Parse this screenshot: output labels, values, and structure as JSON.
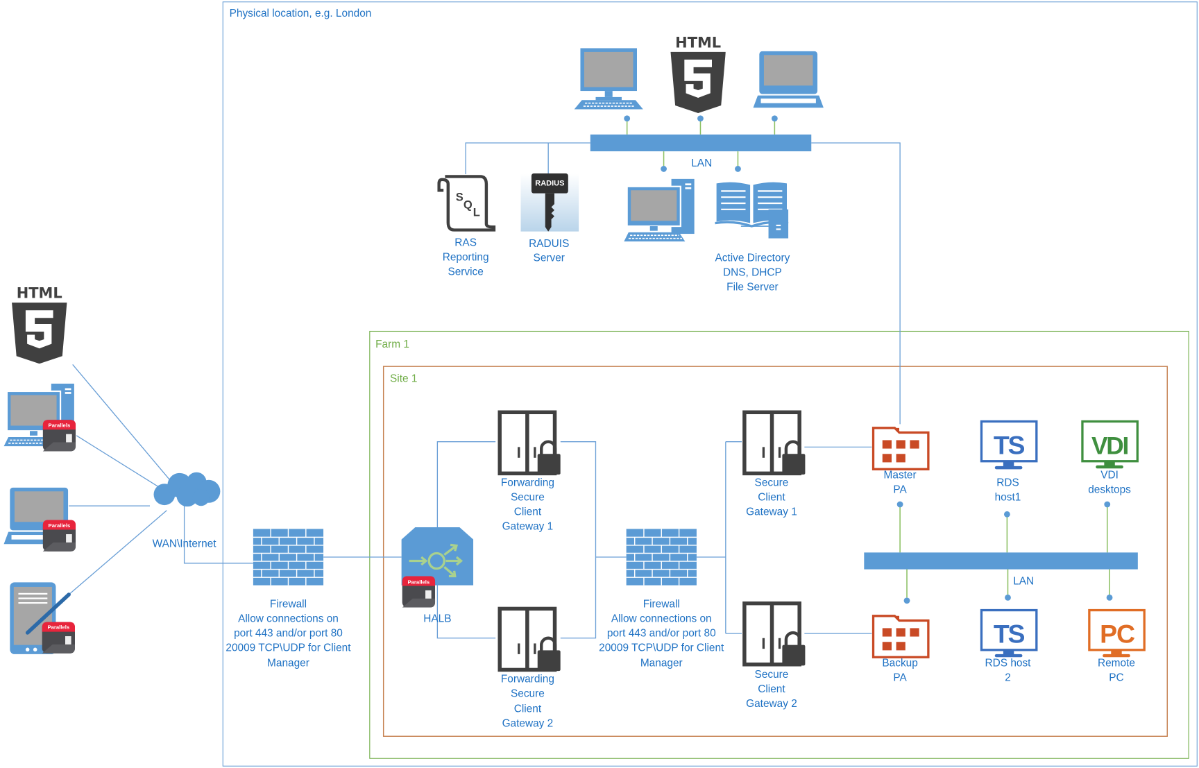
{
  "containers": {
    "physical_location": "Physical location, e.g. London",
    "farm": "Farm 1",
    "site": "Site 1"
  },
  "colors": {
    "physical_border": "#6a9fd6",
    "farm_border": "#70ad47",
    "site_border": "#c5804f",
    "label_text": "#1f72c4",
    "icon_blue": "#5b9bd5",
    "icon_dark": "#404040",
    "publishing_agent": "#c94a25",
    "ts": "#3a6fbf",
    "vdi": "#3f8f3f",
    "pc": "#e06d25",
    "parallels_red": "#e8243c"
  },
  "lan_top": {
    "label": "LAN"
  },
  "lan_site": {
    "label": "LAN"
  },
  "clients": {
    "html5_badge": "HTML",
    "wan": "WAN\\Internet",
    "parallels_badge": "Parallels"
  },
  "top_html5": {
    "badge": "HTML"
  },
  "nodes": {
    "ras_reporting": {
      "icon": "sql-icon",
      "badge": "SQL",
      "lines": [
        "RAS",
        "Reporting",
        "Service"
      ]
    },
    "radius": {
      "icon": "radius-key-icon",
      "badge": "RADIUS",
      "lines": [
        "RADUIS",
        "Server"
      ]
    },
    "active_directory": {
      "icon": "directory-book-icon",
      "lines": [
        "Active Directory",
        "DNS, DHCP",
        "File Server"
      ]
    },
    "firewall_1": {
      "icon": "firewall-icon",
      "lines": [
        "Firewall",
        "Allow connections on",
        "port 443 and/or port 80",
        "20009 TCP\\UDP for Client",
        "Manager"
      ]
    },
    "halb": {
      "icon": "load-balancer-icon",
      "lines": [
        "HALB"
      ]
    },
    "fscg_1": {
      "icon": "gateway-lock-icon",
      "lines": [
        "Forwarding",
        "Secure",
        "Client",
        "Gateway 1"
      ]
    },
    "fscg_2": {
      "icon": "gateway-lock-icon",
      "lines": [
        "Forwarding",
        "Secure",
        "Client",
        "Gateway 2"
      ]
    },
    "firewall_2": {
      "icon": "firewall-icon",
      "lines": [
        "Firewall",
        "Allow connections on",
        "port 443 and/or port 80",
        "20009 TCP\\UDP for Client",
        "Manager"
      ]
    },
    "scg_1": {
      "icon": "gateway-lock-icon",
      "lines": [
        "Secure",
        "Client",
        "Gateway 1"
      ]
    },
    "scg_2": {
      "icon": "gateway-lock-icon",
      "lines": [
        "Secure",
        "Client",
        "Gateway 2"
      ]
    },
    "master_pa": {
      "icon": "publishing-agent-folder-icon",
      "lines": [
        "Master",
        "PA"
      ]
    },
    "backup_pa": {
      "icon": "publishing-agent-folder-icon",
      "lines": [
        "Backup",
        "PA"
      ]
    },
    "rds_host_1": {
      "icon": "ts-monitor-icon",
      "badge": "TS",
      "lines": [
        "RDS",
        "host1"
      ]
    },
    "rds_host_2": {
      "icon": "ts-monitor-icon",
      "badge": "TS",
      "lines": [
        "RDS host",
        "2"
      ]
    },
    "vdi": {
      "icon": "vdi-monitor-icon",
      "badge": "VDI",
      "lines": [
        "VDI",
        "desktops"
      ]
    },
    "remote_pc": {
      "icon": "pc-monitor-icon",
      "badge": "PC",
      "lines": [
        "Remote",
        "PC"
      ]
    }
  }
}
